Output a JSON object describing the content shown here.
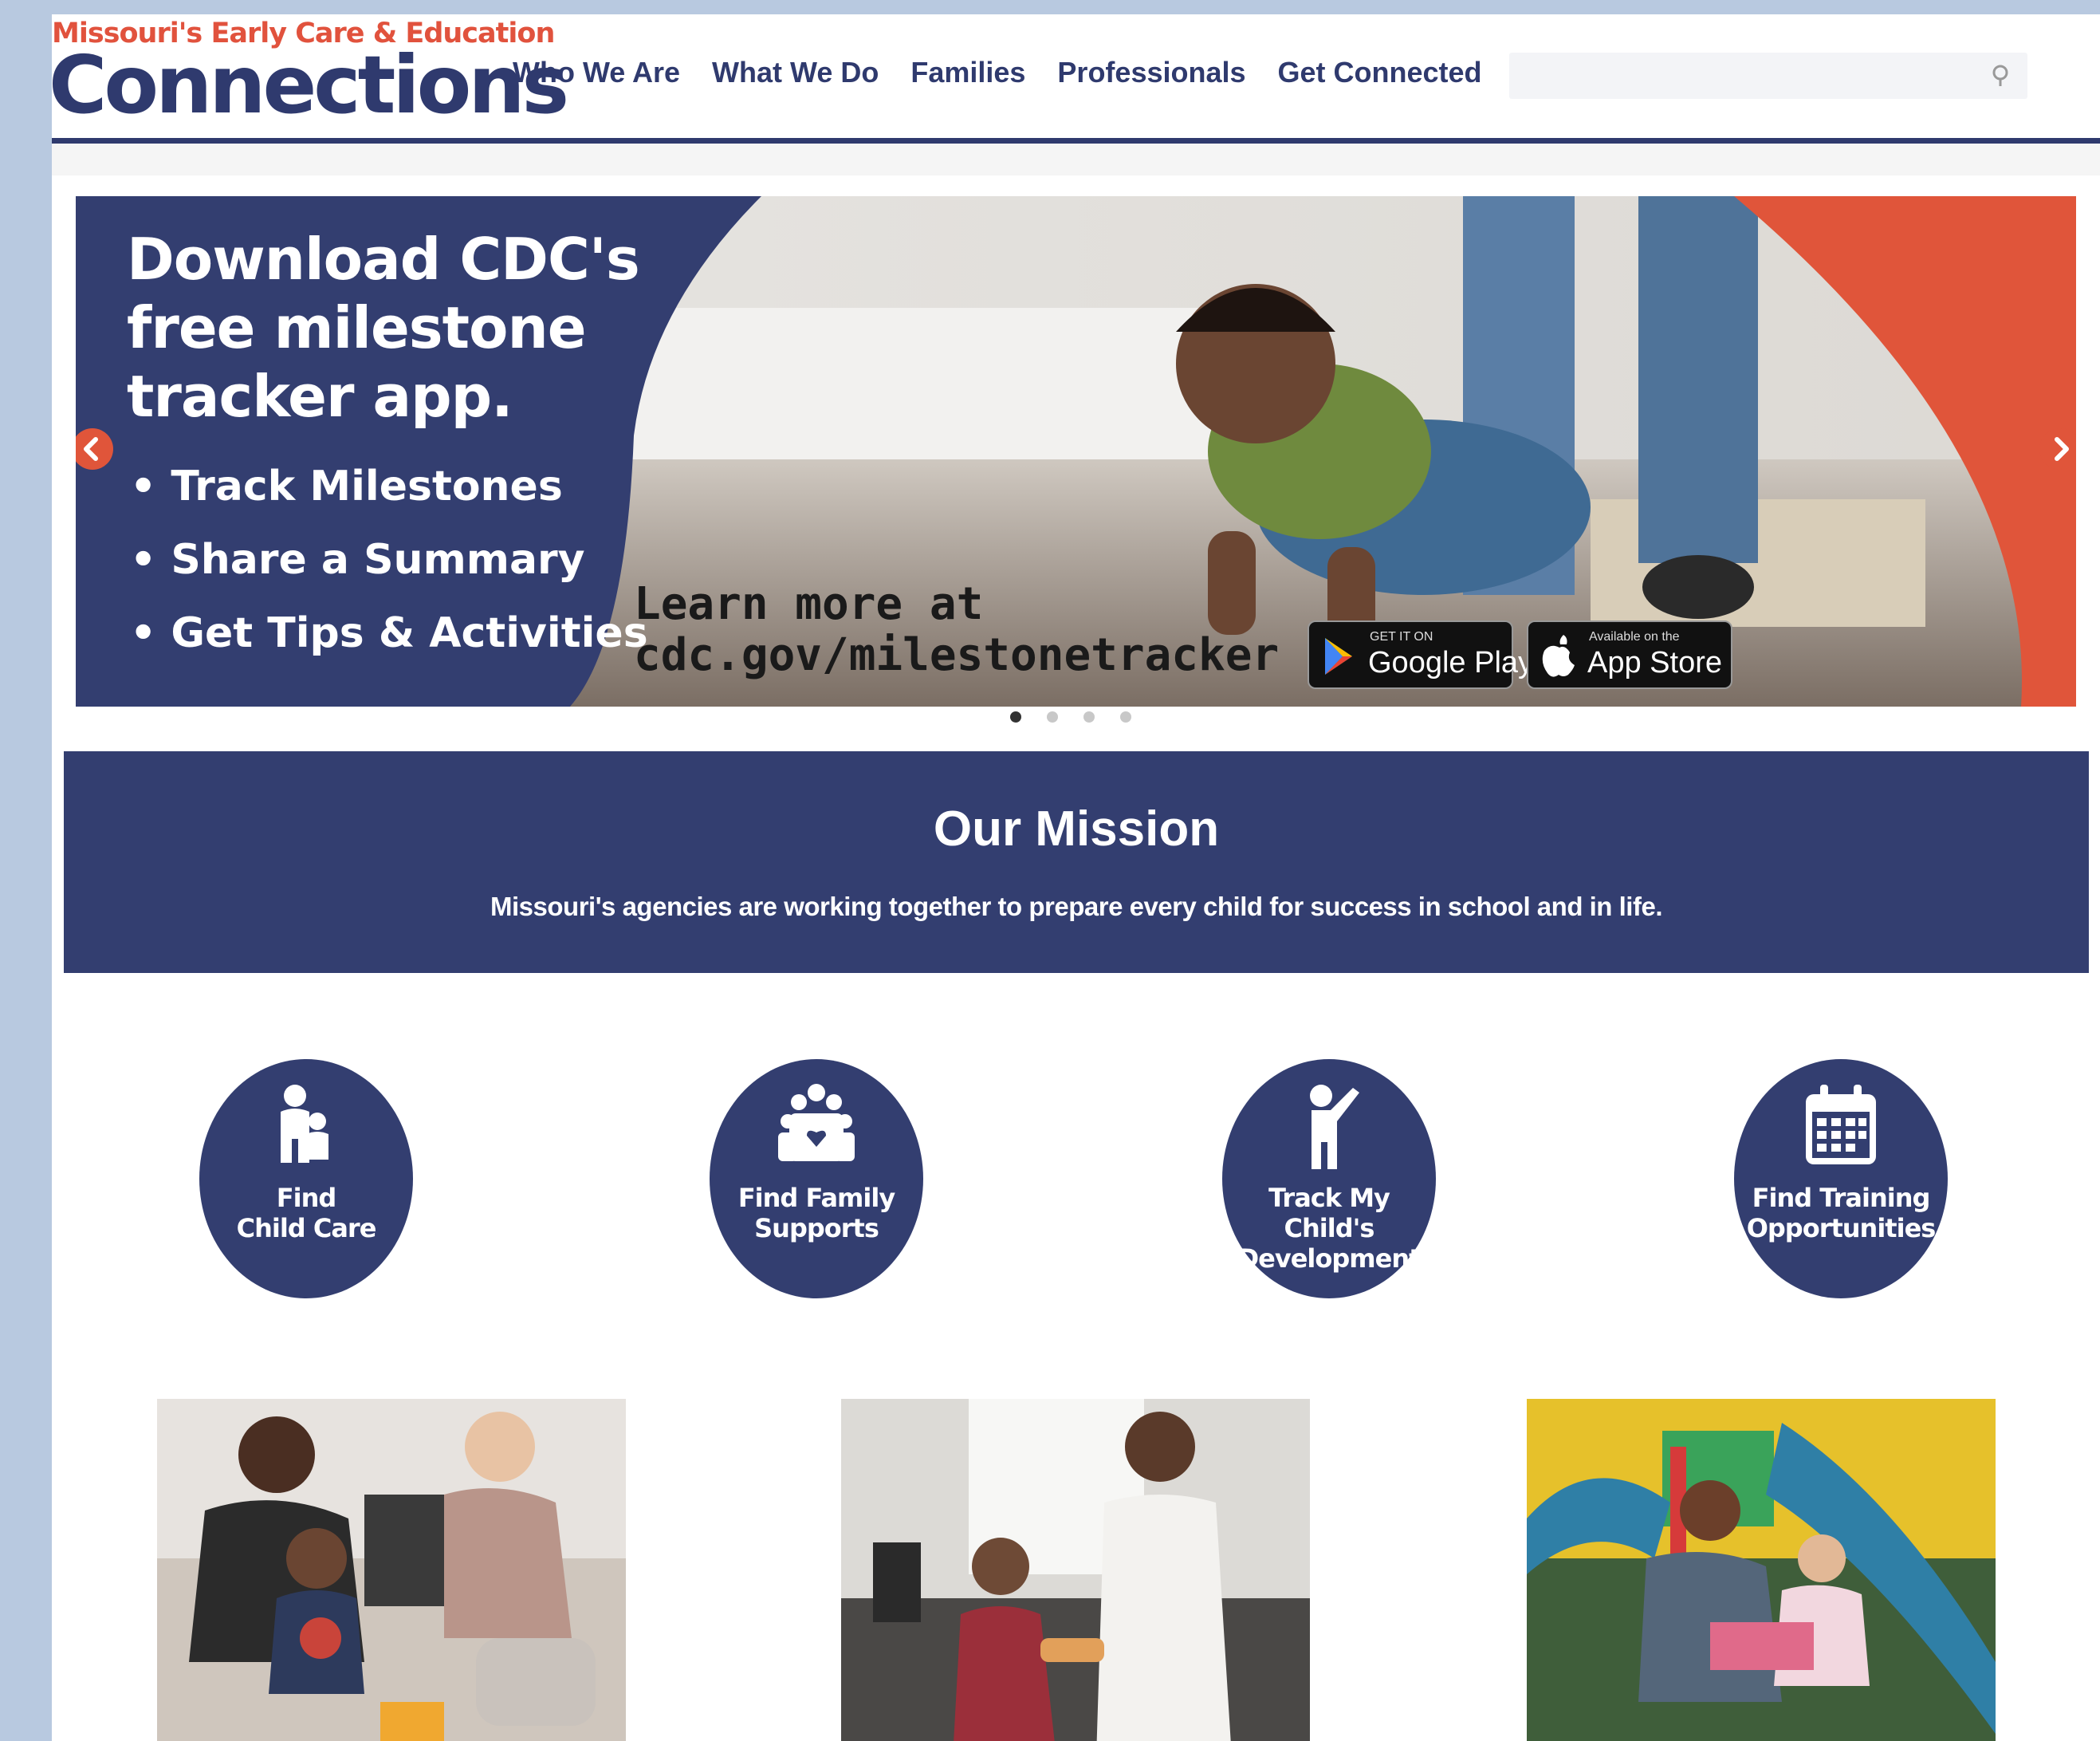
{
  "logo": {
    "tagline": "Missouri's Early Care & Education",
    "name": "Connections"
  },
  "nav": {
    "items": [
      {
        "label": "Who We Are"
      },
      {
        "label": "What We Do"
      },
      {
        "label": "Families"
      },
      {
        "label": "Professionals"
      },
      {
        "label": "Get Connected"
      }
    ]
  },
  "search": {
    "placeholder": "",
    "icon": "search-icon"
  },
  "hero": {
    "title": "Download CDC's free milestone tracker app.",
    "bullets": [
      "• Track Milestones",
      "• Share a Summary",
      "• Get Tips & Activities"
    ],
    "learn_line1": "Learn more at",
    "learn_line2": "cdc.gov/milestonetracker",
    "google_small": "GET IT ON",
    "google_big": "Google Play",
    "apple_small": "Available on the",
    "apple_big": "App Store",
    "active_slide": 1,
    "slide_count": 4
  },
  "mission": {
    "title": "Our Mission",
    "text": "Missouri's agencies are working together to prepare every child for success in school and in life."
  },
  "circles": [
    {
      "label": "Find\nChild Care",
      "icon": "parent-child-icon"
    },
    {
      "label": "Find Family\nSupports",
      "icon": "family-icon"
    },
    {
      "label": "Track My Child's\nDevelopment",
      "icon": "child-raising-hand-icon"
    },
    {
      "label": "Find Training\nOpportunities",
      "icon": "calendar-icon"
    }
  ],
  "colors": {
    "navy": "#333e70",
    "accent": "#e1523d",
    "background": "#b8c9e0"
  }
}
